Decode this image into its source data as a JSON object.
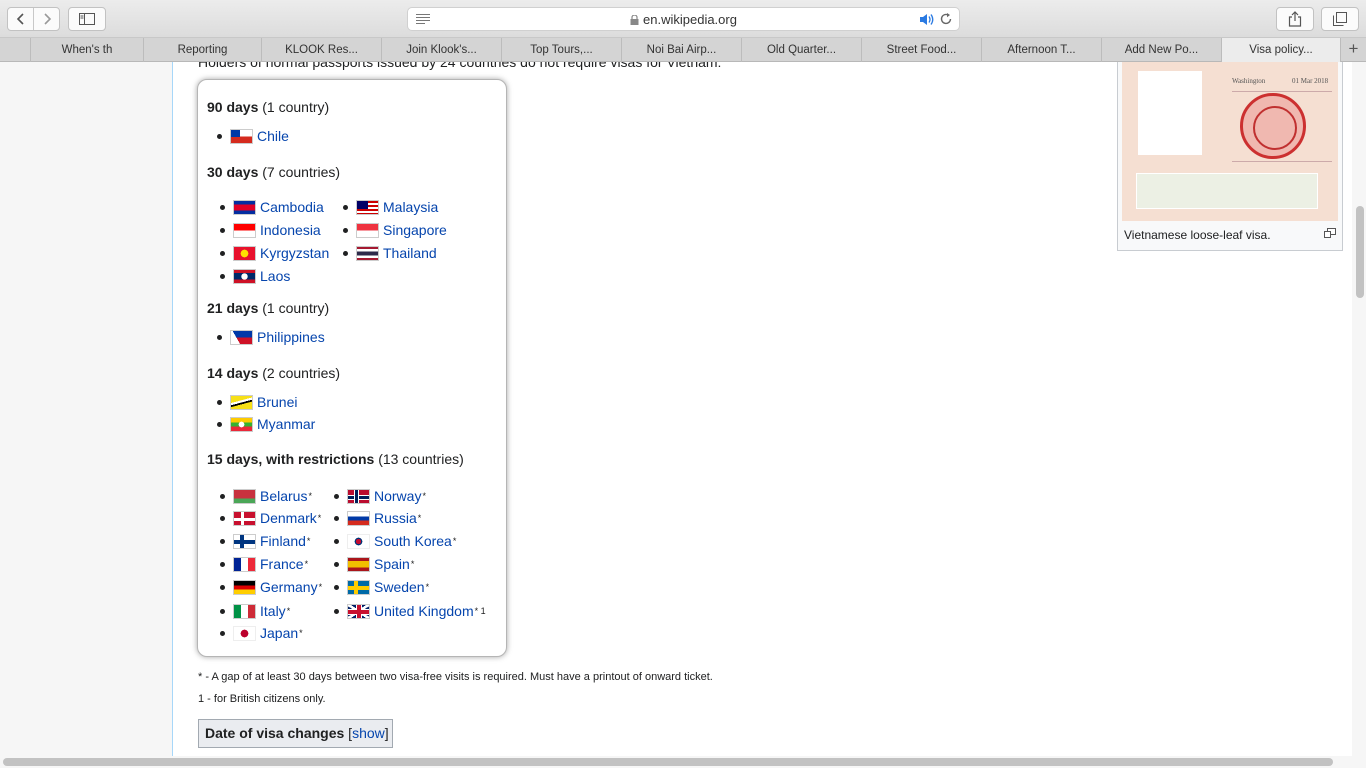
{
  "browser": {
    "url": "en.wikipedia.org",
    "tabs": [
      {
        "label": "When's th"
      },
      {
        "label": "Reporting"
      },
      {
        "label": "KLOOK Res..."
      },
      {
        "label": "Join Klook's..."
      },
      {
        "label": "Top Tours,..."
      },
      {
        "label": "Noi Bai Airp..."
      },
      {
        "label": "Old Quarter..."
      },
      {
        "label": "Street Food..."
      },
      {
        "label": "Afternoon T..."
      },
      {
        "label": "Add New Po..."
      },
      {
        "label": "Visa policy..."
      }
    ],
    "new_tab_label": "+"
  },
  "article": {
    "intro": "Holders of normal passports issued by 24 countries do not require visas for Vietnam:"
  },
  "visa_box": {
    "groups": [
      {
        "days": "90 days",
        "count": "(1 country)",
        "items": [
          {
            "name": "Chile"
          }
        ]
      },
      {
        "days": "30 days",
        "count": "(7 countries)",
        "items": [
          {
            "name": "Cambodia"
          },
          {
            "name": "Indonesia"
          },
          {
            "name": "Kyrgyzstan"
          },
          {
            "name": "Laos"
          },
          {
            "name": "Malaysia"
          },
          {
            "name": "Singapore"
          },
          {
            "name": "Thailand"
          }
        ]
      },
      {
        "days": "21 days",
        "count": "(1 country)",
        "items": [
          {
            "name": "Philippines"
          }
        ]
      },
      {
        "days": "14 days",
        "count": "(2 countries)",
        "items": [
          {
            "name": "Brunei"
          },
          {
            "name": "Myanmar"
          }
        ]
      },
      {
        "days": "15 days, with restrictions",
        "count": "(13 countries)",
        "items": [
          {
            "name": "Belarus",
            "sup": "*"
          },
          {
            "name": "Denmark",
            "sup": "*"
          },
          {
            "name": "Finland",
            "sup": "*"
          },
          {
            "name": "France",
            "sup": "*"
          },
          {
            "name": "Germany",
            "sup": "*"
          },
          {
            "name": "Italy",
            "sup": "*"
          },
          {
            "name": "Japan",
            "sup": "*"
          },
          {
            "name": "Norway",
            "sup": "*"
          },
          {
            "name": "Russia",
            "sup": "*"
          },
          {
            "name": "South Korea",
            "sup": "*"
          },
          {
            "name": "Spain",
            "sup": "*"
          },
          {
            "name": "Sweden",
            "sup": "*"
          },
          {
            "name": "United Kingdom",
            "sup": "* 1"
          }
        ]
      }
    ]
  },
  "notes": {
    "star": "* - A gap of at least 30 days between two visa-free visits is required. Must have a printout of onward ticket.",
    "one": "1 - for British citizens only."
  },
  "collapsible": {
    "title": "Date of visa changes",
    "toggle_label": "show"
  },
  "thumbnail": {
    "caption": "Vietnamese loose-leaf visa.",
    "stamp_text": "Washington",
    "stamp_date": "01 Mar 2018"
  }
}
